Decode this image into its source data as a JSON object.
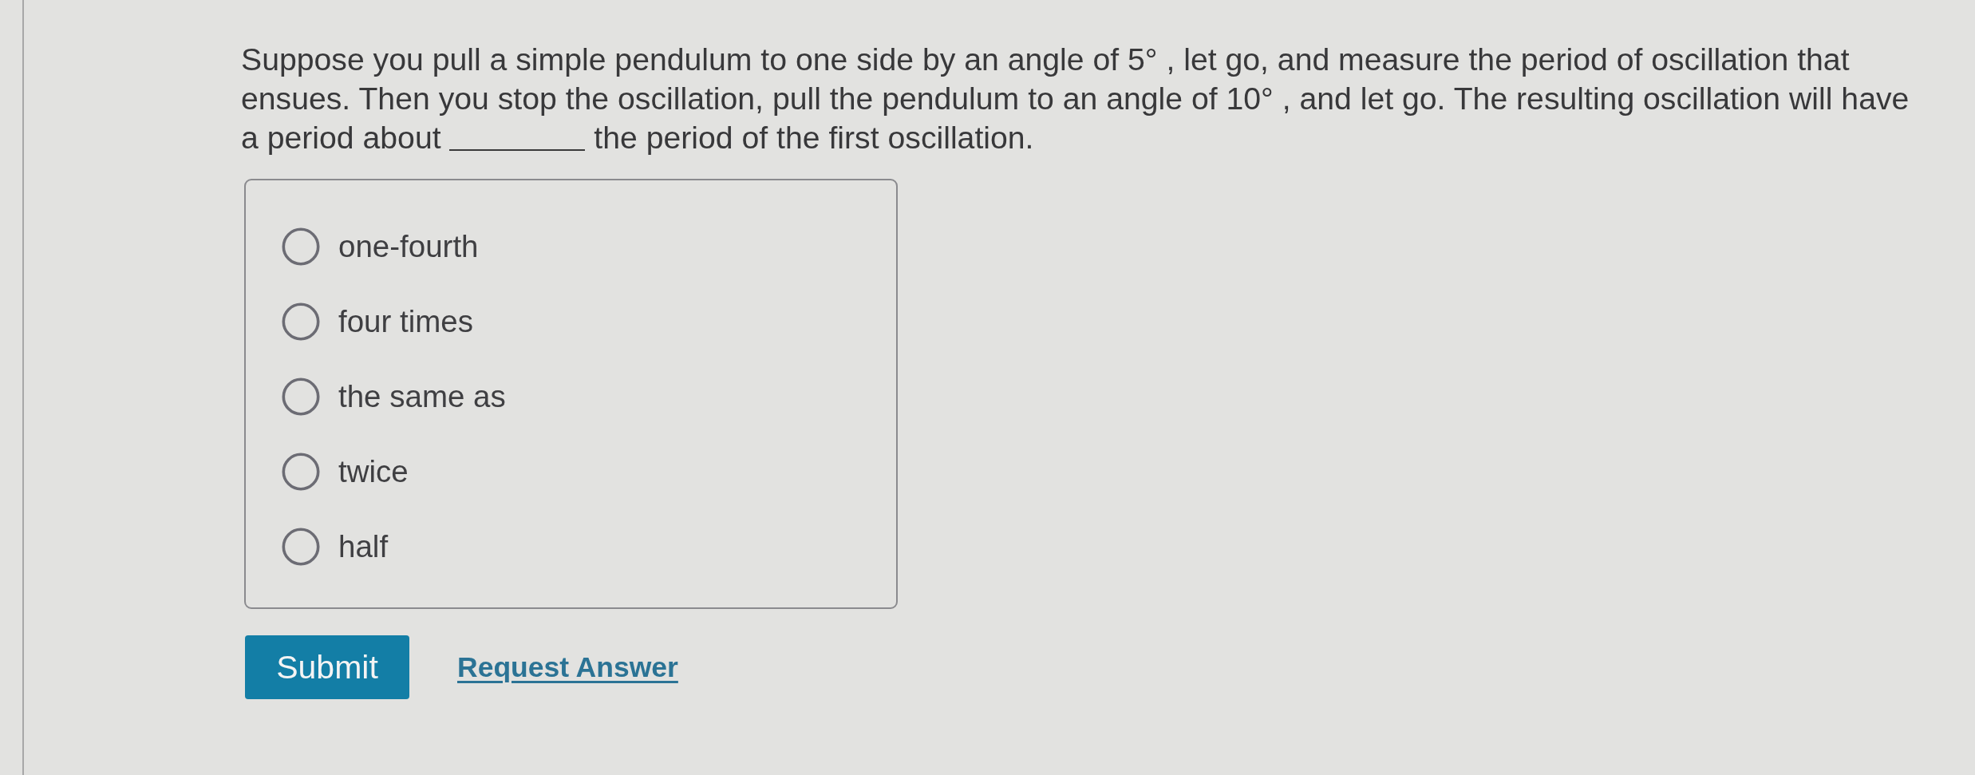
{
  "question": {
    "parts": [
      {
        "kind": "text",
        "text": "Suppose you pull a simple pendulum to one side by an angle of 5° , let go, and measure the period of oscillation that ensues. Then you stop the oscillation, pull the pendulum to an angle of 10° , and let go. The resulting oscillation will have a period about"
      },
      {
        "kind": "blank"
      },
      {
        "kind": "text",
        "text": "the period of the first oscillation."
      }
    ]
  },
  "options": [
    {
      "label": "one-fourth",
      "selected": false
    },
    {
      "label": "four times",
      "selected": false
    },
    {
      "label": "the same as",
      "selected": false
    },
    {
      "label": "twice",
      "selected": false
    },
    {
      "label": "half",
      "selected": false
    }
  ],
  "actions": [
    {
      "kind": "button",
      "label": "Submit"
    },
    {
      "kind": "link",
      "label": "Request Answer"
    }
  ]
}
